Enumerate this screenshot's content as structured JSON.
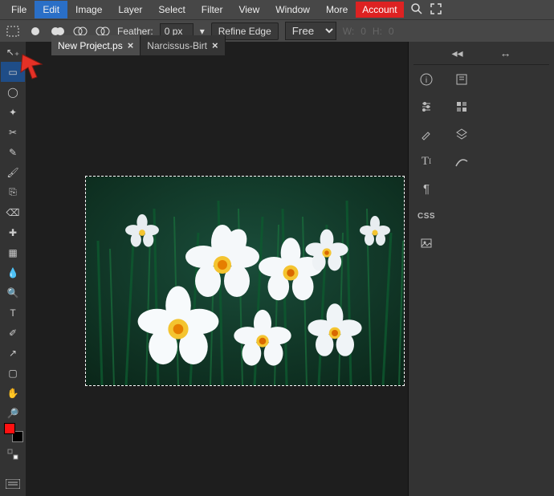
{
  "menu": {
    "items": [
      "File",
      "Edit",
      "Image",
      "Layer",
      "Select",
      "Filter",
      "View",
      "Window",
      "More"
    ],
    "account": "Account"
  },
  "options": {
    "feather_label": "Feather:",
    "feather_value": "0 px",
    "refine_edge": "Refine Edge",
    "mode_select": "Free",
    "w_label": "W:",
    "w_value": "0",
    "h_label": "H:",
    "h_value": "0"
  },
  "tabs": [
    {
      "label": "New Project.ps",
      "active": true
    },
    {
      "label": "Narcissus-Birt",
      "active": false
    }
  ],
  "tools": [
    {
      "name": "move-tool",
      "glyph": "↖₊"
    },
    {
      "name": "marquee-tool",
      "glyph": "▭",
      "selected": true
    },
    {
      "name": "lasso-tool",
      "glyph": "◯"
    },
    {
      "name": "magic-wand-tool",
      "glyph": "✦"
    },
    {
      "name": "crop-tool",
      "glyph": "✂"
    },
    {
      "name": "pencil-tool",
      "glyph": "✎"
    },
    {
      "name": "brush-tool",
      "glyph": "🖌"
    },
    {
      "name": "clone-tool",
      "glyph": "⎘"
    },
    {
      "name": "eraser-tool",
      "glyph": "⌫"
    },
    {
      "name": "healing-tool",
      "glyph": "✚"
    },
    {
      "name": "gradient-tool",
      "glyph": "▦"
    },
    {
      "name": "blur-tool",
      "glyph": "💧"
    },
    {
      "name": "dodge-tool",
      "glyph": "🔍"
    },
    {
      "name": "type-tool",
      "glyph": "T"
    },
    {
      "name": "eyedropper-tool",
      "glyph": "✐"
    },
    {
      "name": "path-tool",
      "glyph": "↗"
    },
    {
      "name": "rectangle-tool",
      "glyph": "▢"
    },
    {
      "name": "hand-tool",
      "glyph": "✋"
    },
    {
      "name": "zoom-tool",
      "glyph": "🔎"
    }
  ],
  "right_panel": {
    "css_label": "CSS"
  },
  "colors": {
    "foreground": "#ff1111",
    "background": "#000000"
  }
}
